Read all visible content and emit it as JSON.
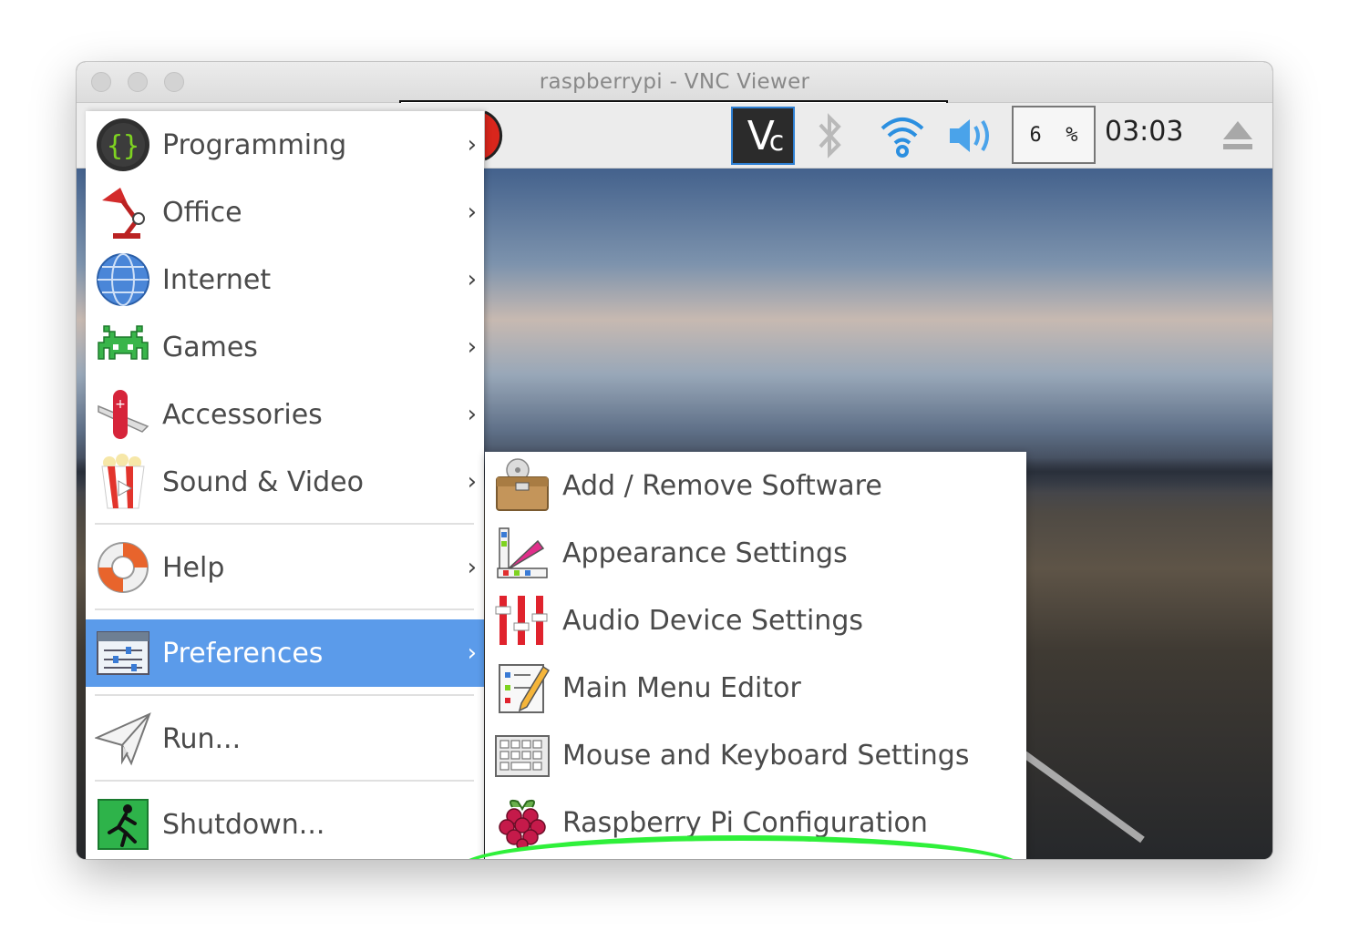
{
  "window": {
    "title": "raspberrypi - VNC Viewer"
  },
  "tray": {
    "cpu_value": "6",
    "cpu_unit": "%",
    "clock": "03:03"
  },
  "main_menu": {
    "items": [
      {
        "label": "Programming",
        "icon": "programming-icon"
      },
      {
        "label": "Office",
        "icon": "office-lamp-icon"
      },
      {
        "label": "Internet",
        "icon": "globe-icon"
      },
      {
        "label": "Games",
        "icon": "space-invader-icon"
      },
      {
        "label": "Accessories",
        "icon": "pocket-knife-icon"
      },
      {
        "label": "Sound & Video",
        "icon": "popcorn-icon"
      },
      {
        "label": "Help",
        "icon": "lifebuoy-icon"
      },
      {
        "label": "Preferences",
        "icon": "preferences-icon"
      },
      {
        "label": "Run...",
        "icon": "paper-plane-icon"
      },
      {
        "label": "Shutdown...",
        "icon": "exit-icon"
      }
    ],
    "chevron": "›"
  },
  "submenu": {
    "items": [
      {
        "label": "Add / Remove Software",
        "icon": "software-box-icon"
      },
      {
        "label": "Appearance Settings",
        "icon": "palette-icon"
      },
      {
        "label": "Audio Device Settings",
        "icon": "audio-sliders-icon"
      },
      {
        "label": "Main Menu Editor",
        "icon": "menu-editor-icon"
      },
      {
        "label": "Mouse and Keyboard Settings",
        "icon": "keyboard-icon"
      },
      {
        "label": "Raspberry Pi Configuration",
        "icon": "raspberry-icon"
      }
    ]
  },
  "colors": {
    "selected": "#5b9bea",
    "highlight": "#2ff03a",
    "vnc_border": "#2d7fd3"
  }
}
